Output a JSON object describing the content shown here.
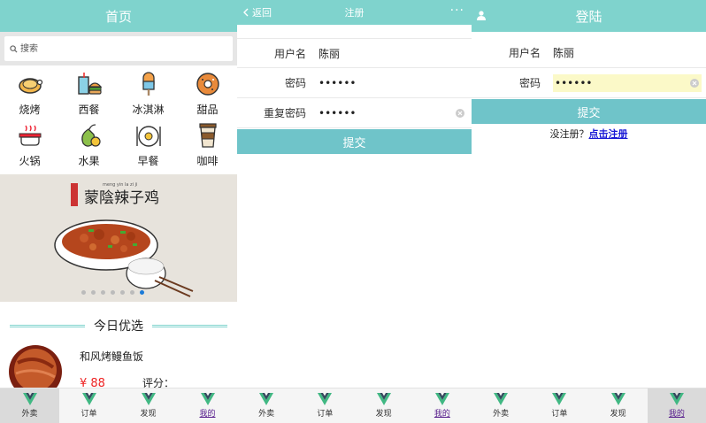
{
  "home": {
    "title": "首页",
    "search_placeholder": "搜索",
    "categories": [
      {
        "label": "烧烤",
        "icon": "roast-chicken-icon"
      },
      {
        "label": "西餐",
        "icon": "drink-burger-icon"
      },
      {
        "label": "冰淇淋",
        "icon": "popsicle-icon"
      },
      {
        "label": "甜品",
        "icon": "donut-icon"
      },
      {
        "label": "火锅",
        "icon": "hotpot-icon"
      },
      {
        "label": "水果",
        "icon": "fruit-icon"
      },
      {
        "label": "早餐",
        "icon": "breakfast-icon"
      },
      {
        "label": "咖啡",
        "icon": "coffee-icon"
      }
    ],
    "banner": {
      "title": "蒙陰辣子鸡",
      "pinyin": "meng yin la zi ji",
      "dot_count": 7,
      "active_dot": 6
    },
    "section_title": "今日优选",
    "product": {
      "name": "和风烤鳗鱼饭",
      "price": "¥ 88",
      "rating_label": "评分："
    }
  },
  "register": {
    "back_label": "返回",
    "title": "注册",
    "more": "···",
    "fields": [
      {
        "label": "用户名",
        "value": "陈丽"
      },
      {
        "label": "密码",
        "value": "••••••"
      },
      {
        "label": "重复密码",
        "value": "••••••"
      }
    ],
    "submit": "提交"
  },
  "login": {
    "title": "登陆",
    "fields": [
      {
        "label": "用户名",
        "value": "陈丽"
      },
      {
        "label": "密码",
        "value": "••••••"
      }
    ],
    "submit": "提交",
    "no_account": "没注册？",
    "register_link": "点击注册"
  },
  "tabbar": {
    "tabs": [
      {
        "label": "外卖",
        "icon": "vue-logo-icon"
      },
      {
        "label": "订单",
        "icon": "vue-logo-icon"
      },
      {
        "label": "发现",
        "icon": "vue-logo-icon"
      },
      {
        "label": "我的",
        "icon": "vue-logo-icon"
      }
    ]
  },
  "colors": {
    "accent": "#7fd3cd",
    "button": "#6fc4c9",
    "price": "#e22222",
    "vue_green": "#41b883",
    "vue_dark": "#35495e"
  }
}
